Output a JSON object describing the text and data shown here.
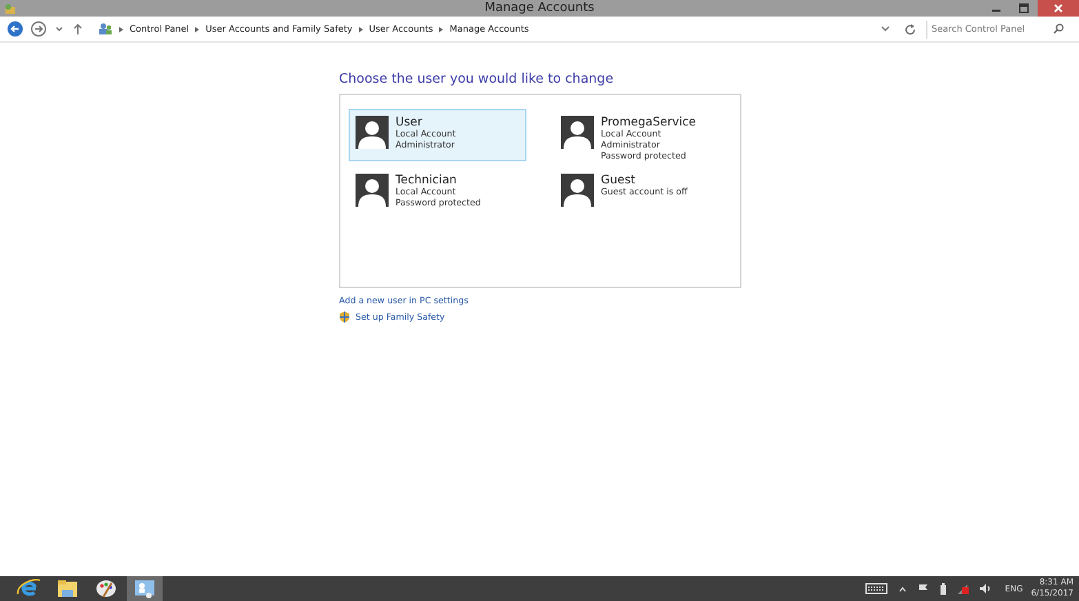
{
  "window": {
    "title": "Manage Accounts"
  },
  "breadcrumb": [
    "Control Panel",
    "User Accounts and Family Safety",
    "User Accounts",
    "Manage Accounts"
  ],
  "search": {
    "placeholder": "Search Control Panel"
  },
  "heading": "Choose the user you would like to change",
  "accounts": [
    {
      "name": "User",
      "details": [
        "Local Account",
        "Administrator"
      ],
      "selected": true
    },
    {
      "name": "PromegaService",
      "details": [
        "Local Account",
        "Administrator",
        "Password protected"
      ],
      "selected": false
    },
    {
      "name": "Technician",
      "details": [
        "Local Account",
        "Password protected"
      ],
      "selected": false
    },
    {
      "name": "Guest",
      "details": [
        "Guest account is off"
      ],
      "selected": false
    }
  ],
  "links": [
    {
      "label": "Add a new user in PC settings",
      "kind": "plain"
    },
    {
      "label": "Set up Family Safety",
      "kind": "shield"
    }
  ],
  "taskbar": {
    "apps": [
      {
        "kind": "browser",
        "selected": false
      },
      {
        "kind": "folder",
        "selected": false
      },
      {
        "kind": "paint",
        "selected": false
      },
      {
        "kind": "users",
        "selected": true
      }
    ],
    "language": "ENG",
    "time": "8:31 AM",
    "date": "6/15/2017"
  }
}
